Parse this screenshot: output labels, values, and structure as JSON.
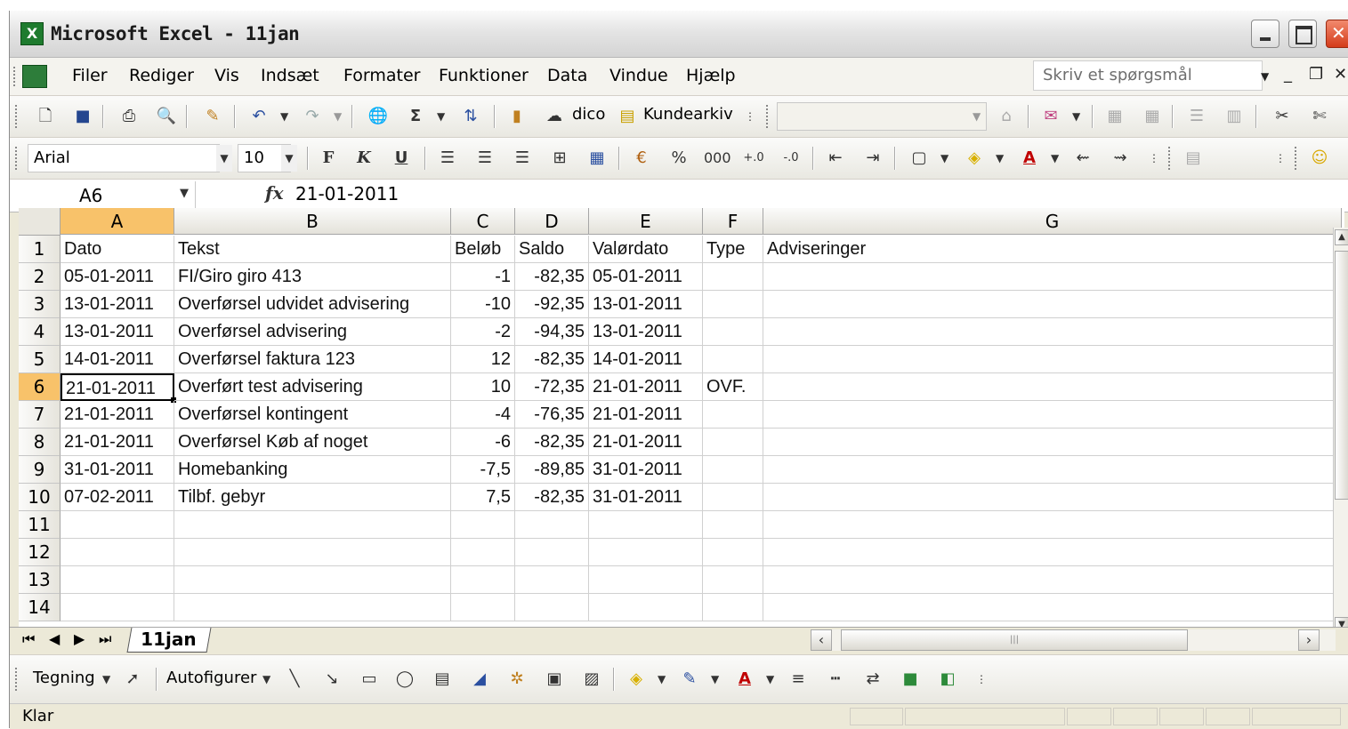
{
  "window": {
    "title": "Microsoft Excel - 11jan"
  },
  "menu": {
    "items": [
      "Filer",
      "Rediger",
      "Vis",
      "Indsæt",
      "Formater",
      "Funktioner",
      "Data",
      "Vindue",
      "Hjælp"
    ],
    "help_placeholder": "Skriv et spørgsmål"
  },
  "toolbar": {
    "dico_label": "dico",
    "kundearkiv_label": "Kundearkiv",
    "font_name": "Arial",
    "font_size": "10",
    "bold_label": "F",
    "italic_label": "K",
    "underline_label": "U",
    "percent_label": "%",
    "thousands_label": "000"
  },
  "formula_bar": {
    "name_box": "A6",
    "fx": "fx",
    "value": "21-01-2011"
  },
  "grid": {
    "columns": [
      "A",
      "B",
      "C",
      "D",
      "E",
      "F",
      "G"
    ],
    "selected_column": "A",
    "row_numbers": [
      "1",
      "2",
      "3",
      "4",
      "5",
      "6",
      "7",
      "8",
      "9",
      "10",
      "11",
      "12",
      "13",
      "14"
    ],
    "selected_row": "6",
    "rows": [
      [
        "Dato",
        "Tekst",
        "Beløb",
        "Saldo",
        "Valørdato",
        "Type",
        "Adviseringer"
      ],
      [
        "05-01-2011",
        "FI/Giro giro 413",
        "-1",
        "-82,35",
        "05-01-2011",
        "",
        ""
      ],
      [
        "13-01-2011",
        "Overførsel udvidet advisering",
        "-10",
        "-92,35",
        "13-01-2011",
        "",
        ""
      ],
      [
        "13-01-2011",
        "Overførsel advisering",
        "-2",
        "-94,35",
        "13-01-2011",
        "",
        ""
      ],
      [
        "14-01-2011",
        "Overførsel faktura 123",
        "12",
        "-82,35",
        "14-01-2011",
        "",
        ""
      ],
      [
        "21-01-2011",
        "Overført test advisering",
        "10",
        "-72,35",
        "21-01-2011",
        "OVF.",
        ""
      ],
      [
        "21-01-2011",
        "Overførsel kontingent",
        "-4",
        "-76,35",
        "21-01-2011",
        "",
        ""
      ],
      [
        "21-01-2011",
        "Overførsel Køb af noget",
        "-6",
        "-82,35",
        "21-01-2011",
        "",
        ""
      ],
      [
        "31-01-2011",
        "Homebanking",
        "-7,5",
        "-89,85",
        "31-01-2011",
        "",
        ""
      ],
      [
        "07-02-2011",
        "Tilbf. gebyr",
        "7,5",
        "-82,35",
        "31-01-2011",
        "",
        ""
      ]
    ]
  },
  "sheets": {
    "tabs": [
      "11jan"
    ],
    "active": "11jan"
  },
  "drawing_toolbar": {
    "tegning_label": "Tegning",
    "autofigurer_label": "Autofigurer"
  },
  "status": {
    "text": "Klar"
  },
  "colors": {
    "selection_header": "#f8c26a",
    "excel_green": "#1e7b2e",
    "close_red": "#d43b1a"
  }
}
